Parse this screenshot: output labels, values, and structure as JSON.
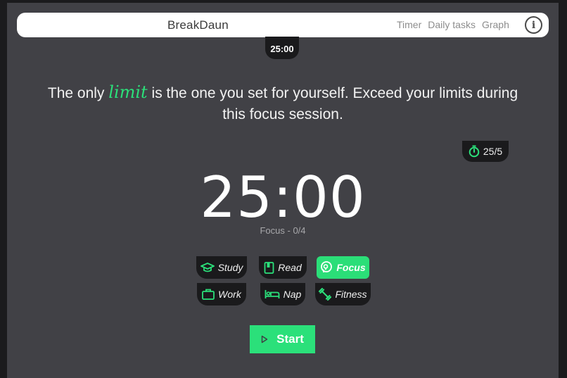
{
  "navbar": {
    "brand": "BreakDaun",
    "links": [
      "Timer",
      "Daily tasks",
      "Graph"
    ],
    "info": "i"
  },
  "mini_timer": "25:00",
  "quote": {
    "before": "The only ",
    "highlight": "limit",
    "after": " is the one you set for yourself. Exceed your limits during this focus session."
  },
  "preset": "25/5",
  "timer": "25:00",
  "session": "Focus - 0/4",
  "categories": [
    {
      "label": "Study",
      "icon": "graduation-cap-icon",
      "active": false
    },
    {
      "label": "Read",
      "icon": "book-icon",
      "active": false
    },
    {
      "label": "Focus",
      "icon": "head-focus-icon",
      "active": true
    },
    {
      "label": "Work",
      "icon": "briefcase-icon",
      "active": false
    },
    {
      "label": "Nap",
      "icon": "bed-icon",
      "active": false
    },
    {
      "label": "Fitness",
      "icon": "dumbbell-icon",
      "active": false
    }
  ],
  "start_label": "Start",
  "colors": {
    "accent": "#2be07a",
    "panel": "#414146",
    "pill": "#1a1a1c"
  }
}
